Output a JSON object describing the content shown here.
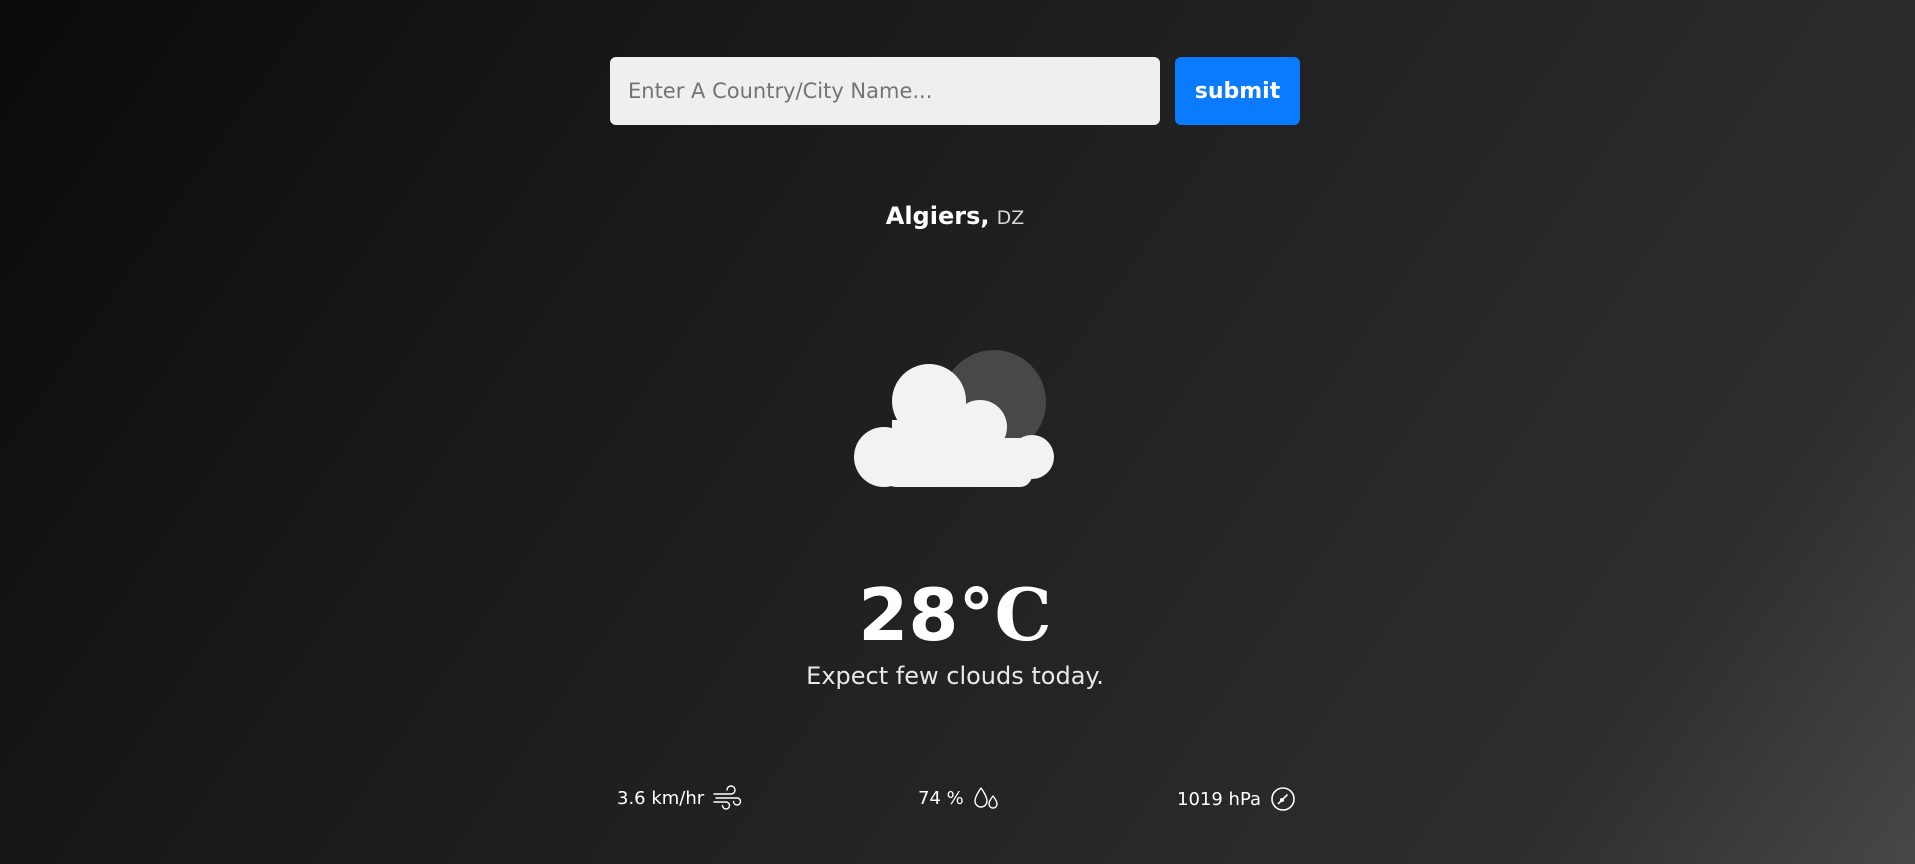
{
  "search": {
    "placeholder": "Enter A Country/City Name...",
    "value": "",
    "submit_label": "submit"
  },
  "location": {
    "city": "Algiers,",
    "country": "DZ"
  },
  "weather": {
    "icon": "few-clouds-night-icon",
    "temperature_value": "28",
    "temperature_unit": "°C",
    "description": "Expect few clouds today."
  },
  "stats": {
    "wind": {
      "value": "3.6 km/hr",
      "icon": "wind-icon"
    },
    "humidity": {
      "value": "74 %",
      "icon": "humidity-icon"
    },
    "pressure": {
      "value": "1019 hPa",
      "icon": "pressure-gauge-icon"
    }
  },
  "colors": {
    "accent": "#0a7bff",
    "input_background": "#efefef",
    "text": "#ffffff"
  }
}
